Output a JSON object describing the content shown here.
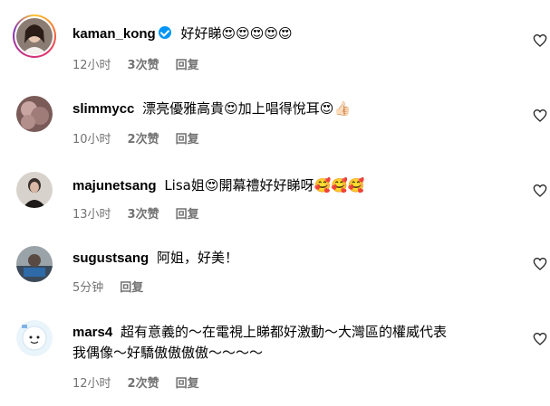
{
  "comments": [
    {
      "username": "kaman_kong",
      "verified": true,
      "text": "好好睇😍😍😍😍😍",
      "time": "12小时",
      "likes": "3次赞",
      "reply": "回复"
    },
    {
      "username": "slimmycc",
      "text": "漂亮優雅高貴😍加上唱得悅耳😍👍🏻",
      "time": "10小时",
      "likes": "2次赞",
      "reply": "回复"
    },
    {
      "username": "majunetsang",
      "text": "Lisa姐😍開幕禮好好睇呀🥰🥰🥰",
      "time": "13小时",
      "likes": "3次赞",
      "reply": "回复"
    },
    {
      "username": "sugustsang",
      "text": "阿姐，好美！",
      "time": "5分钟",
      "reply": "回复"
    },
    {
      "username": "mars4",
      "text_line1": "超有意義的～在電視上睇都好激動～大灣區的權威代表",
      "text_line2": "我偶像～好驕傲傲傲傲～～～～",
      "time": "12小时",
      "likes": "2次赞",
      "reply": "回复"
    }
  ],
  "icons": {
    "like": "heart-outline-icon",
    "verified": "verified-badge-icon"
  }
}
